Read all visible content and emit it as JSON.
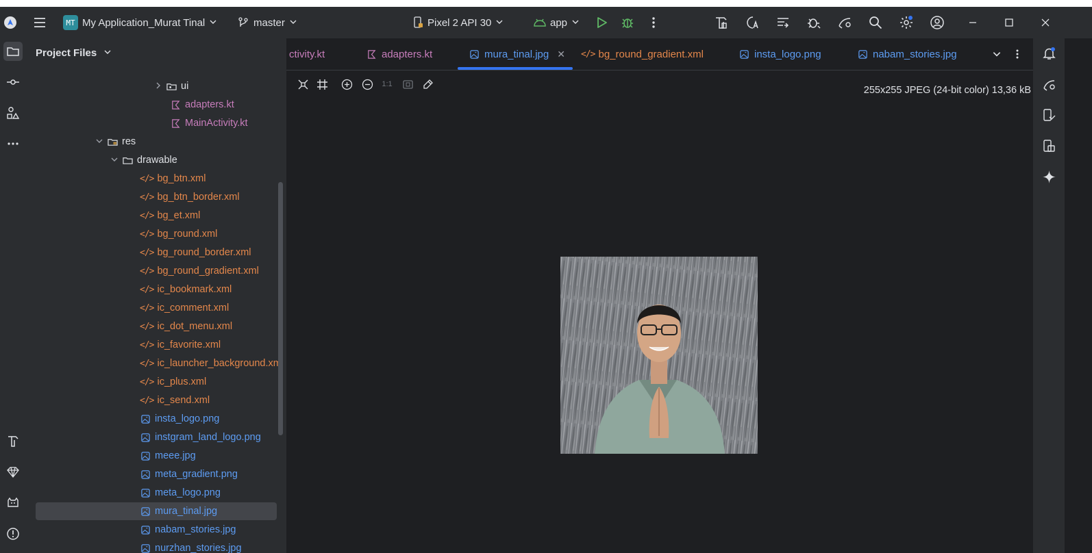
{
  "titlebar": {
    "project_badge": "MT",
    "project_name": "My Application_Murat Tinal",
    "branch": "master",
    "device": "Pixel 2 API 30",
    "run_config": "app"
  },
  "panel": {
    "title": "Project Files"
  },
  "tree": [
    {
      "label": "ui",
      "kind": "dir",
      "indent": 1
    },
    {
      "label": "adapters.kt",
      "kind": "kt"
    },
    {
      "label": "MainActivity.kt",
      "kind": "kt"
    },
    {
      "label": "res",
      "kind": "dir"
    },
    {
      "label": "drawable",
      "kind": "dir"
    },
    {
      "label": "bg_btn.xml",
      "kind": "xml"
    },
    {
      "label": "bg_btn_border.xml",
      "kind": "xml"
    },
    {
      "label": "bg_et.xml",
      "kind": "xml"
    },
    {
      "label": "bg_round.xml",
      "kind": "xml"
    },
    {
      "label": "bg_round_border.xml",
      "kind": "xml"
    },
    {
      "label": "bg_round_gradient.xml",
      "kind": "xml"
    },
    {
      "label": "ic_bookmark.xml",
      "kind": "xml"
    },
    {
      "label": "ic_comment.xml",
      "kind": "xml"
    },
    {
      "label": "ic_dot_menu.xml",
      "kind": "xml"
    },
    {
      "label": "ic_favorite.xml",
      "kind": "xml"
    },
    {
      "label": "ic_launcher_background.xm",
      "kind": "xml"
    },
    {
      "label": "ic_plus.xml",
      "kind": "xml"
    },
    {
      "label": "ic_send.xml",
      "kind": "xml"
    },
    {
      "label": "insta_logo.png",
      "kind": "img"
    },
    {
      "label": "instgram_land_logo.png",
      "kind": "img"
    },
    {
      "label": "meee.jpg",
      "kind": "img"
    },
    {
      "label": "meta_gradient.png",
      "kind": "img"
    },
    {
      "label": "meta_logo.png",
      "kind": "img"
    },
    {
      "label": "mura_tinal.jpg",
      "kind": "img"
    },
    {
      "label": "nabam_stories.jpg",
      "kind": "img"
    },
    {
      "label": "nurzhan_stories.jpg",
      "kind": "img"
    }
  ],
  "tabs": [
    {
      "label": "ctivity.kt",
      "kind": "none"
    },
    {
      "label": "adapters.kt",
      "kind": "kt"
    },
    {
      "label": "mura_tinal.jpg",
      "kind": "img",
      "active": true
    },
    {
      "label": "bg_round_gradient.xml",
      "kind": "xml"
    },
    {
      "label": "insta_logo.png",
      "kind": "img"
    },
    {
      "label": "nabam_stories.jpg",
      "kind": "img"
    }
  ],
  "editor": {
    "zoom_actual_label": "1:1",
    "image_info": "255x255 JPEG (24-bit color) 13,36 kB"
  },
  "colors": {
    "accent": "#3574f0",
    "run_green": "#5fb865",
    "xml_orange": "#e4874b",
    "image_blue": "#5d9cf2",
    "kotlin_purple": "#c77dbb"
  }
}
